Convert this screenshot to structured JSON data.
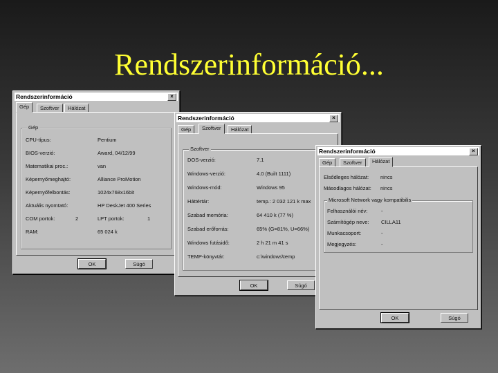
{
  "slide": {
    "title": "Rendszerinformáció..."
  },
  "windows": [
    {
      "title": "Rendszerinformáció",
      "close": "×",
      "tabs": [
        "Gép",
        "Szoftver",
        "Hálózat"
      ],
      "active_tab": 0,
      "group_title": "Gép",
      "rows": [
        {
          "label": "CPU-típus:",
          "value": "Pentium"
        },
        {
          "label": "BIOS-verzió:",
          "value": "Award, 04/12/99"
        },
        {
          "label": "Matematikai proc.:",
          "value": "van"
        },
        {
          "label": "Képernyőmeghajtó:",
          "value": "Alliance ProMotion"
        },
        {
          "label": "Képernyőfelbontás:",
          "value": "1024x768x16bit"
        },
        {
          "label": "Aktuális nyomtató:",
          "value": "HP DeskJet 400 Series"
        },
        {
          "label": "COM portok:",
          "value": "2",
          "label2": "LPT portok:",
          "value2": "1"
        },
        {
          "label": "RAM:",
          "value": "65 024 k"
        }
      ],
      "buttons": {
        "ok": "OK",
        "help": "Súgó"
      }
    },
    {
      "title": "Rendszerinformáció",
      "close": "×",
      "tabs": [
        "Gép",
        "Szoftver",
        "Hálózat"
      ],
      "active_tab": 1,
      "group_title": "Szoftver",
      "rows": [
        {
          "label": "DOS-verzió:",
          "value": "7.1"
        },
        {
          "label": "Windows-verzió:",
          "value": "4.0 (Built 1111)"
        },
        {
          "label": "Windows-mód:",
          "value": "Windows 95"
        },
        {
          "label": "Háttértár:",
          "value": "temp.: 2 032 121 k max"
        },
        {
          "label": "Szabad memória:",
          "value": "64 410 k (77 %)"
        },
        {
          "label": "Szabad erőforrás:",
          "value": "65% (G=81%, U=66%)"
        },
        {
          "label": "Windows futásidő:",
          "value": "2 h 21 m 41 s"
        },
        {
          "label": "TEMP-könyvtár:",
          "value": "c:\\windows\\temp"
        }
      ],
      "buttons": {
        "ok": "OK",
        "help": "Súgó"
      }
    },
    {
      "title": "Rendszerinformáció",
      "close": "×",
      "tabs": [
        "Gép",
        "Szoftver",
        "Hálózat"
      ],
      "active_tab": 2,
      "top_rows": [
        {
          "label": "Elsődleges hálózat:",
          "value": "nincs"
        },
        {
          "label": "Másodlagos hálózat:",
          "value": "nincs"
        }
      ],
      "group_title": "Microsoft Network vagy kompatibilis",
      "rows": [
        {
          "label": "Felhasználói név:",
          "value": "-"
        },
        {
          "label": "Számítógép neve:",
          "value": "CILLA11"
        },
        {
          "label": "Munkacsoport:",
          "value": "-"
        },
        {
          "label": "Megjegyzés:",
          "value": "-"
        }
      ],
      "buttons": {
        "ok": "OK",
        "help": "Súgó"
      }
    }
  ]
}
